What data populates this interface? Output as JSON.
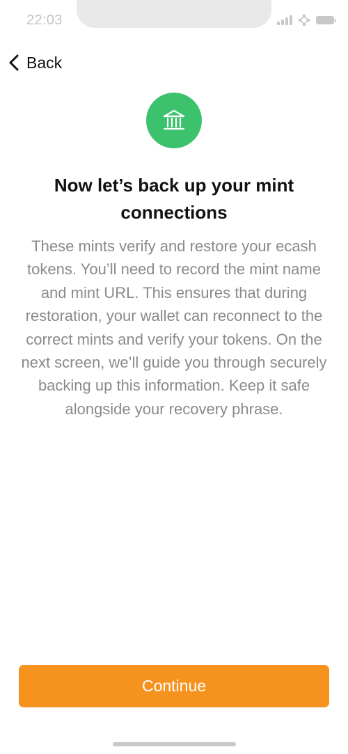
{
  "status_bar": {
    "time": "22:03"
  },
  "header": {
    "back_label": "Back"
  },
  "badge": {
    "icon": "bank-icon",
    "color": "#3cc26c"
  },
  "content": {
    "title": "Now let’s back up your mint connections",
    "body": "These mints verify and restore your ecash tokens. You’ll need to record the mint name and mint URL. This ensures that during restoration, your wallet can reconnect to the correct mints and verify your tokens. On the next screen, we’ll guide you through securely backing up this information. Keep it safe alongside your recovery phrase."
  },
  "footer": {
    "continue_label": "Continue",
    "continue_color": "#f6931e"
  }
}
